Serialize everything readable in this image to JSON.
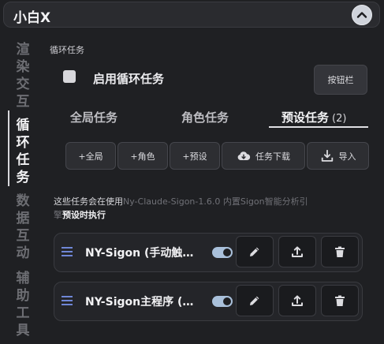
{
  "header": {
    "title": "小白X"
  },
  "sidebar": {
    "items": [
      {
        "label": "渲染交互",
        "chars": [
          "渲",
          "染",
          "交",
          "互"
        ]
      },
      {
        "label": "循环任务",
        "chars": [
          "循",
          "环",
          "任",
          "务"
        ]
      },
      {
        "label": "数据互动",
        "chars": [
          "数",
          "据",
          "互",
          "动"
        ]
      },
      {
        "label": "辅助工具",
        "chars": [
          "辅",
          "助",
          "工",
          "具"
        ]
      }
    ]
  },
  "section": {
    "label": "循环任务",
    "enable_label": "启用循环任务",
    "toolbar_button": "按钮栏"
  },
  "tabs": [
    {
      "label": "全局任务"
    },
    {
      "label": "角色任务"
    },
    {
      "label": "预设任务",
      "count": "(2)"
    }
  ],
  "actions": [
    {
      "label": "+全局"
    },
    {
      "label": "+角色"
    },
    {
      "label": "+预设"
    },
    {
      "label": "任务下载",
      "icon": "cloud-download-icon"
    },
    {
      "label": "导入",
      "icon": "import-icon"
    }
  ],
  "description": {
    "part1": "这些任务会在使用",
    "muted": "Ny-Claude-Sigon-1.6.0 内置Sigon智能分析引",
    "part2": "擎",
    "bold": "预设时执行"
  },
  "tasks": [
    {
      "name": "NY-Sigon (手动触…",
      "enabled": true
    },
    {
      "name": "NY-Sigon主程序 (…",
      "enabled": true
    }
  ],
  "colors": {
    "accent": "#a9c0da",
    "drag_icon": "#6f86d6"
  }
}
